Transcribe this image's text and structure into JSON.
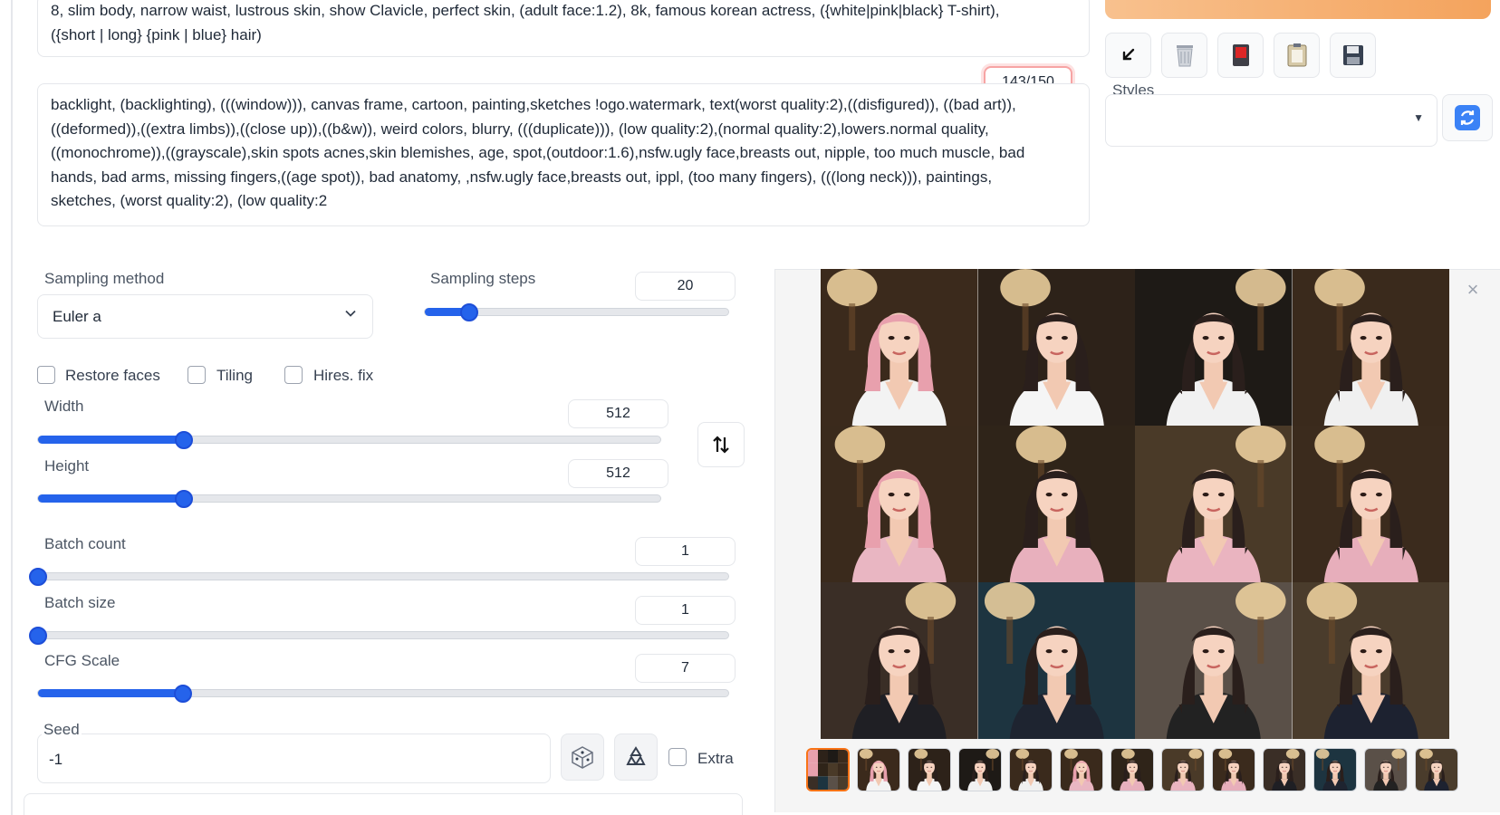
{
  "prompt": {
    "positive_lines": [
      "8, slim body, narrow waist,  lustrous skin, show Clavicle, perfect skin, (adult face:1.2), 8k, famous korean actress, ({white|pink|black} T-shirt),",
      "({short | long} {pink | blue} hair)"
    ],
    "negative_lines": [
      "backlight, (backlighting), (((window))), canvas frame, cartoon, painting,sketches !ogo.watermark, text(worst quality:2),((disfigured)), ((bad art)),",
      "((deformed)),((extra limbs)),((close up)),((b&w)), weird colors, blurry, (((duplicate))), (low quality:2),(normal quality:2),lowers.normal quality,",
      "((monochrome)),((grayscale),skin spots acnes,skin blemishes, age, spot,(outdoor:1.6),nsfw.ugly face,breasts out, nipple, too much muscle, bad",
      "hands, bad arms, missing fingers,((age spot)), bad anatomy, ,nsfw.ugly face,breasts out, ippl, (too many fingers), (((long neck))), paintings,",
      "sketches, (worst quality:2), (low quality:2"
    ],
    "token_counter": "143/150"
  },
  "toolbar": {
    "icons": [
      "arrow-down-left-icon",
      "trash-icon",
      "card-icon",
      "clipboard-icon",
      "save-icon",
      "refresh-icon"
    ],
    "styles_label": "Styles",
    "styles_value": ""
  },
  "params": {
    "sampling_method_label": "Sampling method",
    "sampling_method_value": "Euler a",
    "sampling_steps_label": "Sampling steps",
    "sampling_steps_value": "20",
    "sampling_steps_fraction": 0.145,
    "restore_faces_label": "Restore faces",
    "tiling_label": "Tiling",
    "hires_fix_label": "Hires. fix",
    "width_label": "Width",
    "width_value": "512",
    "width_fraction": 0.235,
    "height_label": "Height",
    "height_value": "512",
    "height_fraction": 0.235,
    "batch_count_label": "Batch count",
    "batch_count_value": "1",
    "batch_count_fraction": 0.0,
    "batch_size_label": "Batch size",
    "batch_size_value": "1",
    "batch_size_fraction": 0.0,
    "cfg_label": "CFG Scale",
    "cfg_value": "7",
    "cfg_fraction": 0.21,
    "seed_label": "Seed",
    "seed_value": "-1",
    "extra_label": "Extra"
  },
  "gallery": {
    "grid_rows": 3,
    "grid_cols": 4,
    "thumbnail_count": 13,
    "selected_thumbnail": 0,
    "close_symbol": "×"
  },
  "colors": {
    "accent": "#2563eb",
    "generate": "#f4a35d",
    "hair_pink": "#e8a0ad",
    "hair_dark": "#2a1f1c",
    "lamp": "#f4d7a3"
  }
}
